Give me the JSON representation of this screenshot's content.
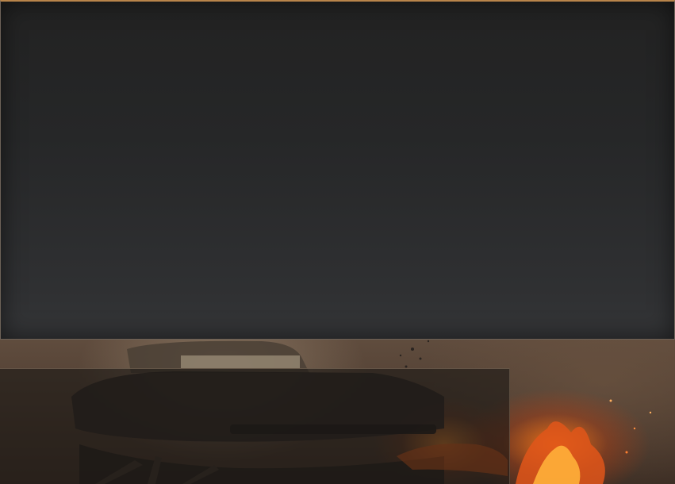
{
  "colors": {
    "panel_top": "#222222",
    "panel_bottom": "#343537",
    "accent_border": "#b8844a",
    "fire": "#ff7a14"
  },
  "scene": {
    "background_icon": "tank-battle-scene"
  }
}
